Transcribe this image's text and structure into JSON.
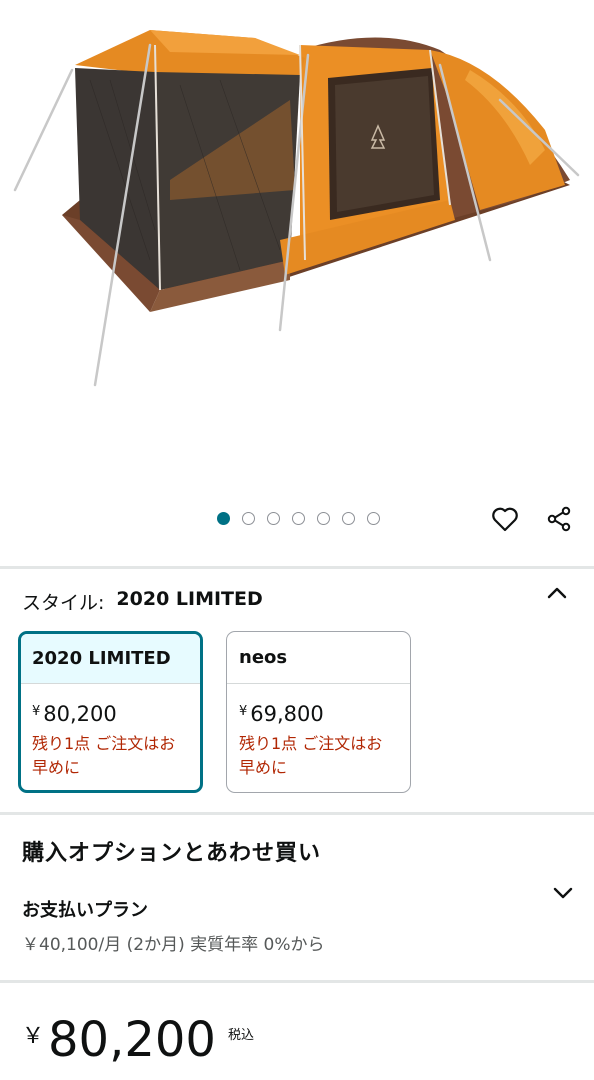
{
  "carousel": {
    "dot_count": 7,
    "active_index": 0
  },
  "actions": {
    "wishlist_icon": "heart-icon",
    "share_icon": "share-icon"
  },
  "style_selector": {
    "label": "スタイル:",
    "selected_value": "2020 LIMITED",
    "options": [
      {
        "name": "2020 LIMITED",
        "yen": "¥",
        "price": "80,200",
        "stock": "残り1点 ご注文はお早めに",
        "selected": true
      },
      {
        "name": "neos",
        "yen": "¥",
        "price": "69,800",
        "stock": "残り1点 ご注文はお早めに",
        "selected": false
      }
    ]
  },
  "buy_options": {
    "title": "購入オプションとあわせ買い",
    "plan_title": "お支払いプラン",
    "plan_detail": "￥40,100/月 (2か月) 実質年率 0%から"
  },
  "price": {
    "yen": "￥",
    "amount": "80,200",
    "tax_label": "税込"
  },
  "colors": {
    "accent": "#007185",
    "stock_red": "#b12704",
    "selected_bg": "#e7fbff"
  }
}
